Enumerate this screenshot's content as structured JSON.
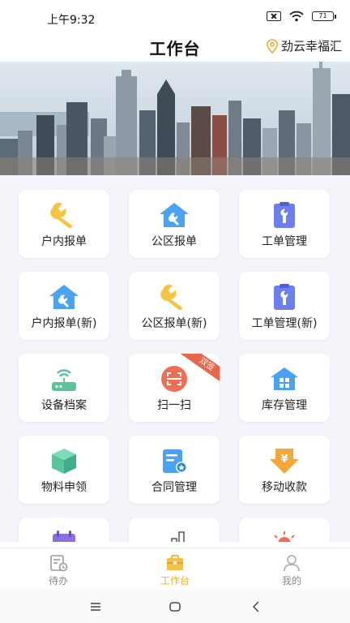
{
  "status_bar": {
    "time": "上午9:32",
    "battery": "71"
  },
  "header": {
    "title": "工作台",
    "location": "劲云幸福汇"
  },
  "colors": {
    "accent": "#e9b230",
    "icon_yellow": "#f6c443",
    "icon_blue": "#4aa3f2",
    "icon_green": "#58c59a",
    "icon_purple": "#8b6fe0",
    "icon_red": "#ee6f55",
    "icon_orange": "#f5a638",
    "ribbon": "#e8664a"
  },
  "grid": [
    {
      "label": "户内报单",
      "icon": "wrench-icon"
    },
    {
      "label": "公区报单",
      "icon": "house-wrench-icon"
    },
    {
      "label": "工单管理",
      "icon": "clipboard-wrench-icon"
    },
    {
      "label": "户内报单(新)",
      "icon": "house-wrench-icon"
    },
    {
      "label": "公区报单(新)",
      "icon": "wrench-icon"
    },
    {
      "label": "工单管理(新)",
      "icon": "clipboard-wrench-icon"
    },
    {
      "label": "设备档案",
      "icon": "router-icon"
    },
    {
      "label": "扫一扫",
      "icon": "scan-icon",
      "badge": "双签"
    },
    {
      "label": "库存管理",
      "icon": "warehouse-icon"
    },
    {
      "label": "物料申领",
      "icon": "box-icon"
    },
    {
      "label": "合同管理",
      "icon": "contract-icon"
    },
    {
      "label": "移动收款",
      "icon": "yuan-down-icon"
    },
    {
      "label": "",
      "icon": "calendar-icon"
    },
    {
      "label": "",
      "icon": "bar-chart-icon"
    },
    {
      "label": "",
      "icon": "sun-icon"
    }
  ],
  "tabs": [
    {
      "label": "待办",
      "icon": "todo-icon",
      "active": false
    },
    {
      "label": "工作台",
      "icon": "briefcase-icon",
      "active": true
    },
    {
      "label": "我的",
      "icon": "person-icon",
      "active": false
    }
  ]
}
